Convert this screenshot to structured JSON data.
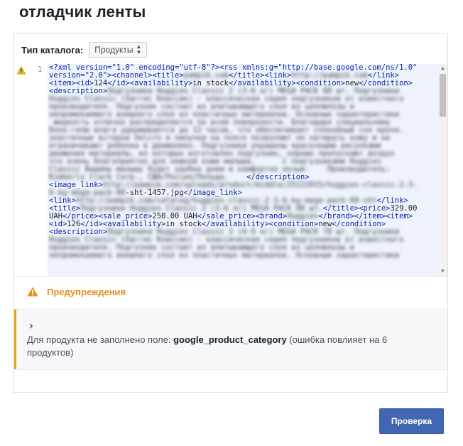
{
  "page": {
    "title": "отладчик ленты"
  },
  "catalog": {
    "label": "Тип каталога:",
    "selected": "Продукты"
  },
  "editor": {
    "line_number": "1",
    "lines": [
      [
        {
          "c": "t",
          "v": "<?xml version=\"1.0\" encoding=\"utf-8\"?><rss xmlns:g=\"http://base.google.com/ns/1.0\""
        }
      ],
      [
        {
          "c": "t",
          "v": "version=\"2.0\"><channel><title>"
        },
        {
          "c": "blur",
          "v": "pampik.com"
        },
        {
          "c": "t",
          "v": "</title><link>"
        },
        {
          "c": "blur",
          "v": "http://pampik.com"
        },
        {
          "c": "t",
          "v": "</link>"
        }
      ],
      [
        {
          "c": "t",
          "v": "<item><id>"
        },
        {
          "c": "p",
          "v": "124"
        },
        {
          "c": "t",
          "v": "</id><availability>"
        },
        {
          "c": "p",
          "v": "in stock"
        },
        {
          "c": "t",
          "v": "</availability><condition>"
        },
        {
          "c": "p",
          "v": "new"
        },
        {
          "c": "t",
          "v": "</condition>"
        }
      ],
      [
        {
          "c": "t",
          "v": "<description>"
        },
        {
          "c": "blur",
          "v": "Подгузники Huggies Classic 2 (3-6 кг) MEGA PACK 88 шт. Подгузники"
        }
      ],
      [
        {
          "c": "blur",
          "v": "Huggies Classic (Хаггис Классик) - классическая серия подгузников от известного"
        }
      ],
      [
        {
          "c": "blur",
          "v": "производителя. Подгузник состоит из впитывающего слоя из целлюлозы и"
        }
      ],
      [
        {
          "c": "blur",
          "v": "непромокаемого внешнего слоя из пластичных материалов. Основные характеристики"
        }
      ],
      [
        {
          "c": "blur",
          "v": " жидкость отлично распределяется по всей поверхности. Благодаря специальному"
        }
      ],
      [
        {
          "c": "blur",
          "v": "блок-гелю влага удерживается до 12 часов, что обеспечивает спокойный сон крохе."
        }
      ],
      [
        {
          "c": "blur",
          "v": "эластичные вставки Velcro и липучки на поясе позволяют не натирать кожу и не"
        }
      ],
      [
        {
          "c": "blur",
          "v": "ограничивают ребенка в движениях. Подгузники украшены красочными рисунками"
        }
      ],
      [
        {
          "c": "blur",
          "v": "движения материалы, из которых изготовлен подгузник, хорошо пропускают воздух"
        }
      ],
      [
        {
          "c": "blur",
          "v": "что очень благоприятно для нежной кожи малыша.      С подгузниками Huggies"
        }
      ],
      [
        {
          "c": "blur",
          "v": "Classic Вашему малышу будет удобно днем и комфортно ночью.    Производитель:"
        }
      ],
      [
        {
          "c": "blur",
          "v": "Kimberly Clark Corp., США/Россия/Польша.    "
        },
        {
          "c": "t",
          "v": "</description>"
        }
      ],
      [
        {
          "c": "t",
          "v": "<image_link>"
        },
        {
          "c": "blur",
          "v": "http://pampik.com/uploads/product/middle/25122015/huggies-classic-2-3-"
        }
      ],
      [
        {
          "c": "blur",
          "v": "6-kg-mega-pack-88"
        },
        {
          "c": "p",
          "v": "-sht-1457.jpg"
        },
        {
          "c": "t",
          "v": "</image_link>"
        }
      ],
      [
        {
          "c": "t",
          "v": "<link>"
        },
        {
          "c": "blur",
          "v": "http://pampik.com/catalog/huggies-classic-2-3-6-kg-mega-pack-88-sht"
        },
        {
          "c": "t",
          "v": "</link>"
        }
      ],
      [
        {
          "c": "t",
          "v": "<title>"
        },
        {
          "c": "blur",
          "v": "Подгузники Huggies Classic 2 (3-6 кг) MEGA PACK 88 шт."
        },
        {
          "c": "t",
          "v": "</title><price>"
        },
        {
          "c": "p",
          "v": "329.00"
        }
      ],
      [
        {
          "c": "p",
          "v": "UAH"
        },
        {
          "c": "t",
          "v": "</price><sale_price>"
        },
        {
          "c": "p",
          "v": "250.00 UAH"
        },
        {
          "c": "t",
          "v": "</sale_price><brand>"
        },
        {
          "c": "blur",
          "v": "Huggies"
        },
        {
          "c": "t",
          "v": "</brand></item><item>"
        }
      ],
      [
        {
          "c": "t",
          "v": "<id>"
        },
        {
          "c": "p",
          "v": "126"
        },
        {
          "c": "t",
          "v": "</id><availability>"
        },
        {
          "c": "p",
          "v": "in stock"
        },
        {
          "c": "t",
          "v": "</availability><condition>"
        },
        {
          "c": "p",
          "v": "new"
        },
        {
          "c": "t",
          "v": "</condition>"
        }
      ],
      [
        {
          "c": "t",
          "v": "<description>"
        },
        {
          "c": "blur",
          "v": "Подгузники Huggies Classic 3 (4-9 кг) MEGA PACK 78 шт. Подгузники"
        }
      ],
      [
        {
          "c": "blur",
          "v": "Huggies Classic (Хаггис Классик) - классическая серия подгузников от известного"
        }
      ],
      [
        {
          "c": "blur",
          "v": "производителя. Подгузник состоит из впитывающего слоя из целлюлозы и"
        }
      ],
      [
        {
          "c": "blur",
          "v": "непромокаемого внешнего слоя из пластичных материалов. Основные характеристики"
        }
      ]
    ]
  },
  "warnings": {
    "title": "Предупреждения",
    "item": {
      "prefix": "Для продукта не заполнено поле: ",
      "field": "google_product_category",
      "suffix": " (ошибка повлияет на 6 продуктов)"
    }
  },
  "actions": {
    "check_label": "Проверка"
  },
  "colors": {
    "accent": "#4267b2",
    "warning": "#e88e1c",
    "warning_stripe": "#e8a31a",
    "xml_tag": "#0e25a7"
  }
}
